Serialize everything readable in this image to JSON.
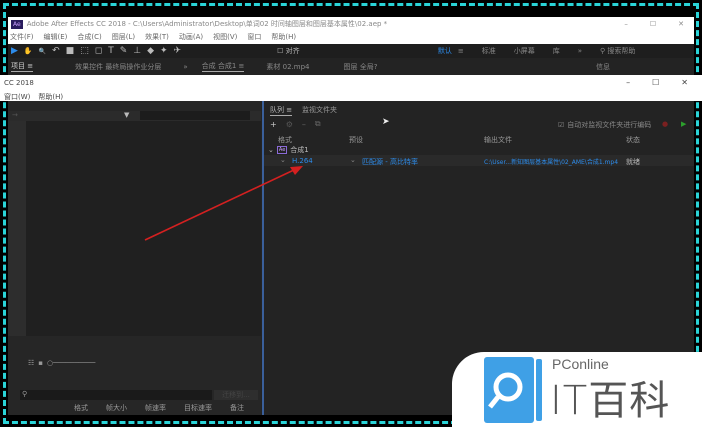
{
  "window": {
    "title": "Adobe After Effects CC 2018 - C:\\Users\\Administrator\\Desktop\\单词02 时间轴图层和图层基本属性\\02.aep *",
    "min": "–",
    "max": "☐",
    "close": "✕"
  },
  "menu": [
    "文件(F)",
    "编辑(E)",
    "合成(C)",
    "图层(L)",
    "效果(T)",
    "动画(A)",
    "视图(V)",
    "窗口",
    "帮助(H)"
  ],
  "toolbar": {
    "tools": [
      "▶",
      "✋",
      "🔍",
      "↶",
      "■",
      "⬚",
      "◻",
      "T",
      "✎",
      "⊥",
      "◆",
      "✦",
      "✈"
    ],
    "snap_label": "对齐",
    "workspaces": [
      "默认",
      "≡",
      "标准",
      "小屏幕",
      "库",
      "»"
    ],
    "search": "搜索帮助"
  },
  "tabs": {
    "project": "项目 ≡",
    "effects": "效果控件 最终局操作业分层",
    "more": "»",
    "comp": "合成 合成1 ≡",
    "footage": "素材 02.mp4",
    "layer": "图层 全局?",
    "info": "信息"
  },
  "second_window": {
    "title": "CC 2018",
    "menu": [
      "窗口(W)",
      "帮助(H)"
    ],
    "min": "–",
    "max": "☐",
    "close": "✕"
  },
  "queue": {
    "tab": "队列 ≡",
    "watch_tab": "监视文件夹",
    "auto_encode": "自动对监视文件夹进行编码",
    "columns": [
      "格式",
      "预设",
      "输出文件",
      "状态"
    ],
    "comp": "合成1",
    "format": "H.264",
    "preset": "匹配源 - 高比特率",
    "output": "C:\\User...新知图层基本属性\\02_AME\\合成1.mp4",
    "status": "就绪"
  },
  "left_bottom": {
    "columns": [
      "格式",
      "帧大小",
      "帧速率",
      "目标速率",
      "备注"
    ],
    "button": "迁移到..."
  },
  "logo": {
    "brand": "PConline",
    "name": "IT百科"
  }
}
